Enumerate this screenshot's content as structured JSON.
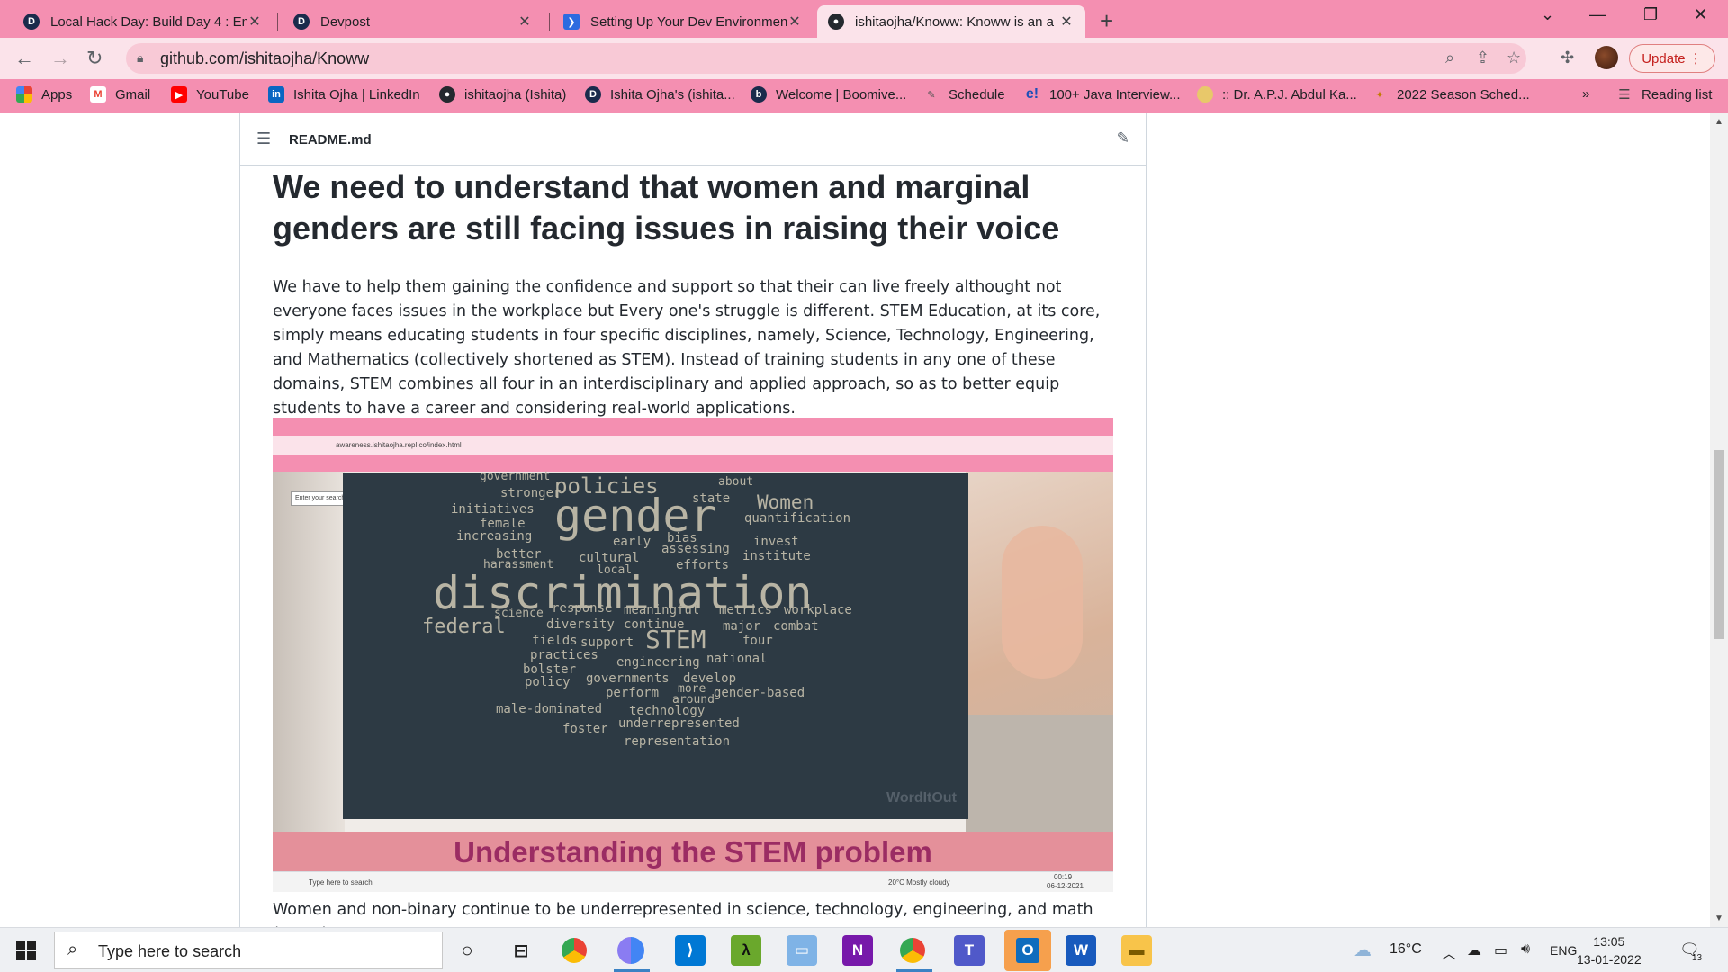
{
  "browser": {
    "tabs": [
      {
        "title": "Local Hack Day: Build Day 4 : Em",
        "favicon": "D",
        "active": false
      },
      {
        "title": "Devpost",
        "favicon": "D",
        "active": false
      },
      {
        "title": "Setting Up Your Dev Environmen",
        "favicon": "slash-icon",
        "active": false
      },
      {
        "title": "ishitaojha/Knoww: Knoww is an a",
        "favicon": "github-icon",
        "active": true
      }
    ],
    "url": "github.com/ishitaojha/Knoww",
    "update_label": "Update",
    "bookmarks": [
      {
        "label": "Apps",
        "icon": "apps-grid-icon"
      },
      {
        "label": "Gmail",
        "icon": "gmail-icon"
      },
      {
        "label": "YouTube",
        "icon": "youtube-icon"
      },
      {
        "label": "Ishita Ojha | LinkedIn",
        "icon": "linkedin-icon"
      },
      {
        "label": "ishitaojha (Ishita)",
        "icon": "github-icon"
      },
      {
        "label": "Ishita Ojha's (ishita...",
        "icon": "devpost-icon"
      },
      {
        "label": "Welcome | Boomive...",
        "icon": "boomive-icon"
      },
      {
        "label": "Schedule",
        "icon": "schedule-icon"
      },
      {
        "label": "100+ Java Interview...",
        "icon": "edureka-icon"
      },
      {
        "label": ":: Dr. A.P.J. Abdul Ka...",
        "icon": "kalam-icon"
      },
      {
        "label": "2022 Season Sched...",
        "icon": "season-icon"
      }
    ],
    "reading_list": "Reading list"
  },
  "readme": {
    "filename": "README.md",
    "heading": "We need to understand that women and marginal genders are still facing issues in raising their voice",
    "paragraph": "We have to help them gaining the confidence and support so that their can live freely althought not everyone faces issues in the workplace but Every one's struggle is different. STEM Education, at its core, simply means educating students in four specific disciplines, namely, Science, Technology, Engineering, and Mathematics (collectively shortened as STEM). Instead of training students in any one of these domains, STEM combines all four in an interdisciplinary and applied approach, so as to better equip students to have a career and considering real-world applications.",
    "image": {
      "url": "awareness.ishitaojha.repl.co/index.html",
      "search_placeholder": "Enter your search term",
      "banner": "Understanding the STEM problem",
      "wordout": "WordItOut",
      "words": [
        "government",
        "policies",
        "about",
        "stronger",
        "state",
        "Women",
        "initiatives",
        "gender",
        "quantification",
        "female",
        "increasing",
        "bias",
        "early",
        "invest",
        "assessing",
        "better",
        "cultural",
        "institute",
        "harassment",
        "local",
        "efforts",
        "discrimination",
        "science",
        "response",
        "meaningful",
        "metrics",
        "workplace",
        "federal",
        "diversity",
        "continue",
        "major",
        "combat",
        "fields",
        "support",
        "STEM",
        "four",
        "practices",
        "engineering",
        "national",
        "bolster",
        "policy",
        "governments",
        "develop",
        "perform",
        "more",
        "around",
        "gender-based",
        "male-dominated",
        "technology",
        "foster",
        "underrepresented",
        "representation"
      ],
      "weather": "20°C  Mostly cloudy",
      "taskbar_search": "Type here to search",
      "clock_time": "00:19",
      "clock_date": "06-12-2021"
    },
    "next_paragraph": "Women and non-binary continue to be underrepresented in science, technology, engineering, and math (STEM)."
  },
  "taskbar": {
    "search_placeholder": "Type here to search",
    "weather": "16°C",
    "language": "ENG",
    "time": "13:05",
    "date": "13-01-2022",
    "notifications": "13"
  },
  "colors": {
    "tabstrip": "#f48fb1",
    "toolbar": "#fbe3ea",
    "update_text": "#c5221f",
    "cloud_bg": "#2d3a44",
    "banner_text": "#9b2c63"
  }
}
